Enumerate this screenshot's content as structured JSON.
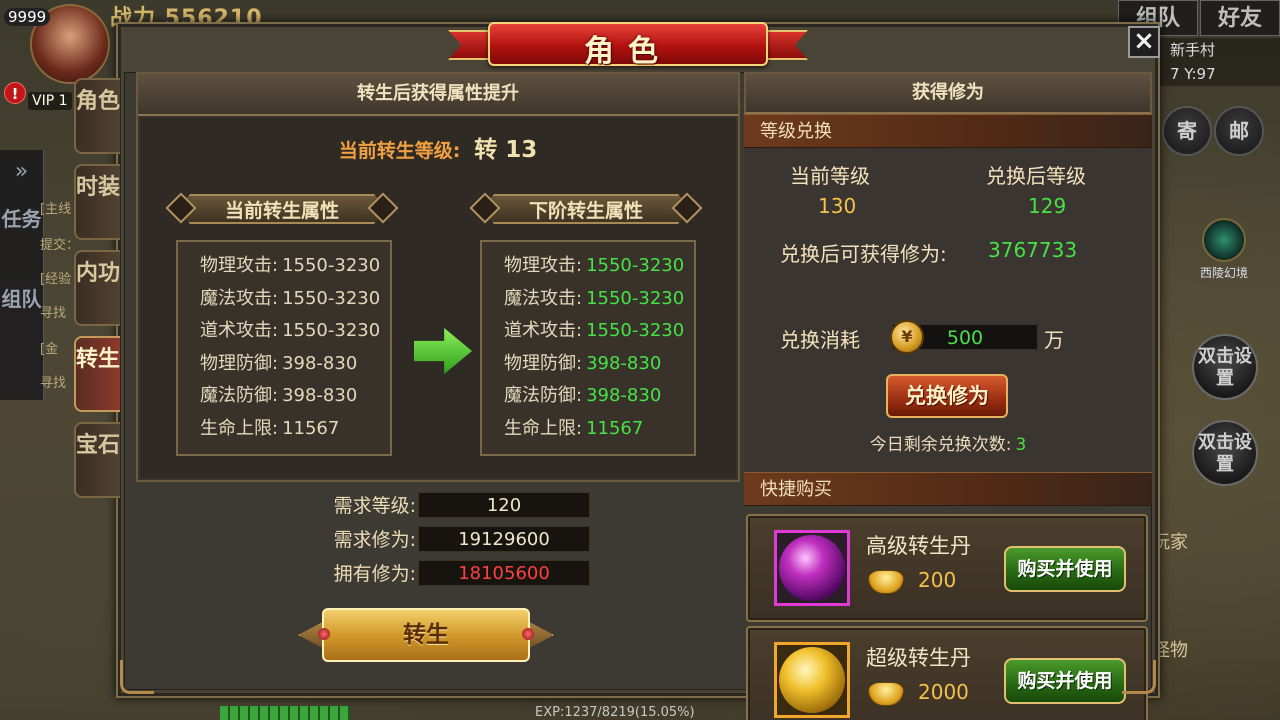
{
  "hud": {
    "level": "9999",
    "power": "战力 556210",
    "vip": "VIP 1",
    "alert": "!",
    "team_tab": "组队",
    "friend_tab": "好友",
    "map_name": "新手村",
    "coords": "7 Y:97",
    "mail_btn_left": "寄",
    "mail_btn_right": "邮",
    "xiling_label": "西陵幻境",
    "double_click_1": "双击设置",
    "double_click_2": "双击设置",
    "player_label": "玩家",
    "monster_label": "怪物",
    "side_task_1": "任务",
    "side_task_2": "组队",
    "side_text_1": "[主线",
    "side_text_2": "提交：",
    "side_text_3": "[经验",
    "side_text_4": "寻找",
    "side_text_5": "[金",
    "side_text_6": "寻找",
    "exp_text": "EXP:1237/8219(15.05%)",
    "exp_progress": 0.1505
  },
  "dialog": {
    "title": "角色",
    "close": "×",
    "tabs": [
      {
        "label": "角色",
        "active": false
      },
      {
        "label": "时装",
        "active": false
      },
      {
        "label": "内功",
        "active": false
      },
      {
        "label": "转生",
        "active": true
      },
      {
        "label": "宝石",
        "active": false
      }
    ]
  },
  "left": {
    "header": "转生后获得属性提升",
    "current_level_label": "当前转生等级:",
    "current_level_value": "转 13",
    "current_attrs_title": "当前转生属性",
    "next_attrs_title": "下阶转生属性",
    "current_attrs": [
      {
        "label": "物理攻击:",
        "value": "1550-3230"
      },
      {
        "label": "魔法攻击:",
        "value": "1550-3230"
      },
      {
        "label": "道术攻击:",
        "value": "1550-3230"
      },
      {
        "label": "物理防御:",
        "value": "398-830"
      },
      {
        "label": "魔法防御:",
        "value": "398-830"
      },
      {
        "label": "生命上限:",
        "value": "11567"
      }
    ],
    "next_attrs": [
      {
        "label": "物理攻击:",
        "value": "1550-3230"
      },
      {
        "label": "魔法攻击:",
        "value": "1550-3230"
      },
      {
        "label": "道术攻击:",
        "value": "1550-3230"
      },
      {
        "label": "物理防御:",
        "value": "398-830"
      },
      {
        "label": "魔法防御:",
        "value": "398-830"
      },
      {
        "label": "生命上限:",
        "value": "11567"
      }
    ],
    "req_level_label": "需求等级:",
    "req_level_value": "120",
    "req_cultivation_label": "需求修为:",
    "req_cultivation_value": "19129600",
    "own_cultivation_label": "拥有修为:",
    "own_cultivation_value": "18105600",
    "rebirth_button": "转生"
  },
  "right": {
    "header": "获得修为",
    "exchange_title": "等级兑换",
    "cur_level_label": "当前等级",
    "cur_level_value": "130",
    "after_level_label": "兑换后等级",
    "after_level_value": "129",
    "gain_label": "兑换后可获得修为:",
    "gain_value": "3767733",
    "cost_label": "兑换消耗",
    "cost_value": "500",
    "cost_unit": "万",
    "exchange_button": "兑换修为",
    "remaining_label": "今日剩余兑换次数:",
    "remaining_value": "3",
    "quick_buy_title": "快捷购买",
    "items": [
      {
        "name": "高级转生丹",
        "price": "200",
        "button": "购买并使用"
      },
      {
        "name": "超级转生丹",
        "price": "2000",
        "button": "购买并使用"
      }
    ]
  },
  "colors": {
    "accent_green": "#48e048",
    "accent_red": "#ff4040",
    "accent_gold": "#f3c24a",
    "level_orange": "#f0a040"
  }
}
